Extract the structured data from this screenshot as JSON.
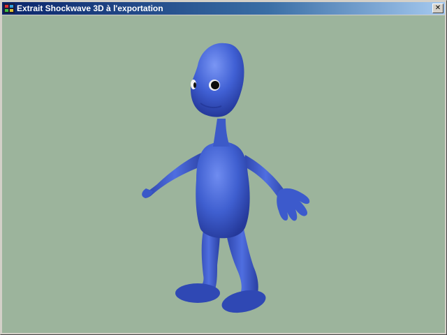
{
  "window": {
    "title": "Extrait Shockwave 3D à l'exportation",
    "close_glyph": "✕",
    "icon": "shockwave-app-icon"
  },
  "viewport": {
    "background_color": "#9cb49c",
    "model": {
      "name": "blue-alien-character",
      "body_color": "#3f5fd0",
      "highlight_color": "#6f8cf0",
      "shadow_color": "#25399a"
    }
  }
}
